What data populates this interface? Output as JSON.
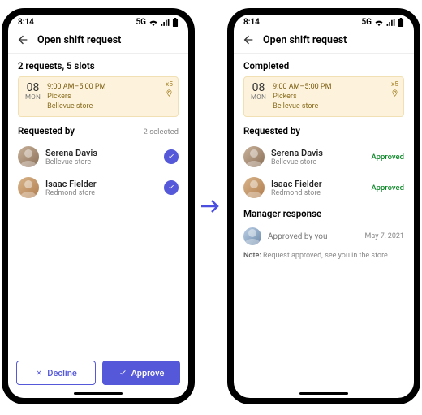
{
  "status": {
    "time": "8:14",
    "net": "5G"
  },
  "appbar": {
    "title": "Open shift request"
  },
  "left": {
    "summary": "2 requests, 5 slots",
    "shift": {
      "daynum": "08",
      "daylbl": "MON",
      "time": "9:00 AM–5:00 PM",
      "role": "Pickers",
      "store": "Bellevue store",
      "slots": "x5"
    },
    "requested_label": "Requested by",
    "selected_hint": "2 selected",
    "people": [
      {
        "name": "Serena Davis",
        "sub": "Bellevue store"
      },
      {
        "name": "Isaac Fielder",
        "sub": "Redmond store"
      }
    ],
    "buttons": {
      "decline": "Decline",
      "approve": "Approve"
    }
  },
  "right": {
    "summary": "Completed",
    "shift": {
      "daynum": "08",
      "daylbl": "MON",
      "time": "9:00 AM–5:00 PM",
      "role": "Pickers",
      "store": "Bellevue store",
      "slots": "x5"
    },
    "requested_label": "Requested by",
    "people": [
      {
        "name": "Serena Davis",
        "sub": "Bellevue store",
        "status": "Approved"
      },
      {
        "name": "Isaac Fielder",
        "sub": "Redmond store",
        "status": "Approved"
      }
    ],
    "mgr_label": "Manager response",
    "mgr_msg": "Approved by you",
    "mgr_date": "May 7, 2021",
    "note_label": "Note:",
    "note_text": "Request approved, see you in the store."
  }
}
